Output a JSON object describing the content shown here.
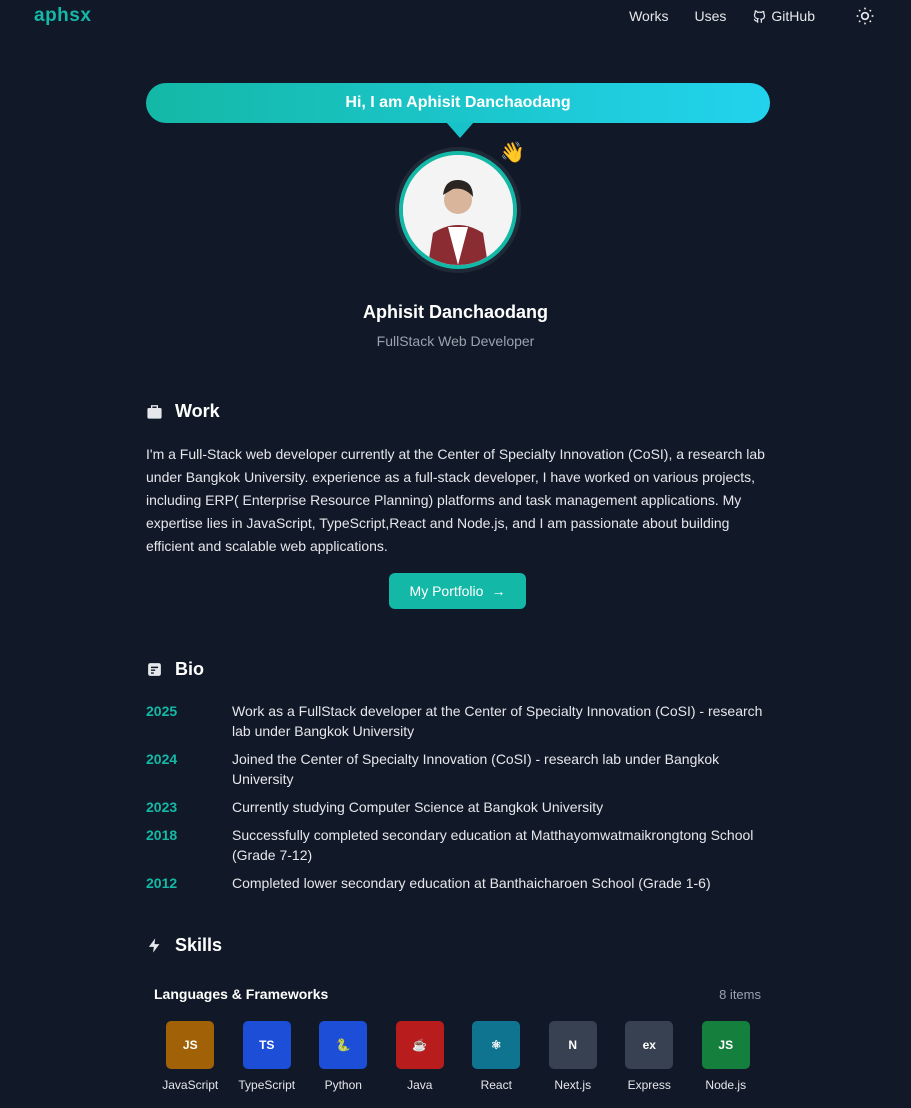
{
  "nav": {
    "logo": "aphsx",
    "links": [
      "Works",
      "Uses",
      "GitHub"
    ]
  },
  "hero": {
    "greeting": "Hi, I am Aphisit Danchaodang",
    "wave": "👋",
    "name": "Aphisit Danchaodang",
    "role": "FullStack Web Developer"
  },
  "work": {
    "title": "Work",
    "text": "I'm a Full-Stack web developer currently at the Center of Specialty Innovation (CoSI), a research lab under Bangkok University. experience as a full-stack developer, I have worked on various projects, including ERP( Enterprise Resource Planning) platforms and task management applications. My expertise lies in JavaScript, TypeScript,React and Node.js, and I am passionate about building efficient and scalable web applications.",
    "button": "My Portfolio",
    "button_arrow": "→"
  },
  "bio": {
    "title": "Bio",
    "items": [
      {
        "year": "2025",
        "text": "Work as a FullStack developer at the Center of Specialty Innovation (CoSI) - research lab under Bangkok University"
      },
      {
        "year": "2024",
        "text": "Joined the Center of Specialty Innovation (CoSI) - research lab under Bangkok University"
      },
      {
        "year": "2023",
        "text": "Currently studying Computer Science at Bangkok University"
      },
      {
        "year": "2018",
        "text": "Successfully completed secondary education at Matthayomwatmaikrongtong School (Grade 7-12)"
      },
      {
        "year": "2012",
        "text": "Completed lower secondary education at Banthaicharoen School (Grade 1-6)"
      }
    ]
  },
  "skills": {
    "title": "Skills",
    "category": "Languages & Frameworks",
    "count": "8 items",
    "items": [
      {
        "label": "JavaScript",
        "glyph": "JS",
        "color": "#a16207"
      },
      {
        "label": "TypeScript",
        "glyph": "TS",
        "color": "#1d4ed8"
      },
      {
        "label": "Python",
        "glyph": "🐍",
        "color": "#1d4ed8"
      },
      {
        "label": "Java",
        "glyph": "☕",
        "color": "#b91c1c"
      },
      {
        "label": "React",
        "glyph": "⚛",
        "color": "#0e7490"
      },
      {
        "label": "Next.js",
        "glyph": "N",
        "color": "#374151"
      },
      {
        "label": "Express",
        "glyph": "ex",
        "color": "#374151"
      },
      {
        "label": "Node.js",
        "glyph": "JS",
        "color": "#15803d"
      }
    ]
  }
}
